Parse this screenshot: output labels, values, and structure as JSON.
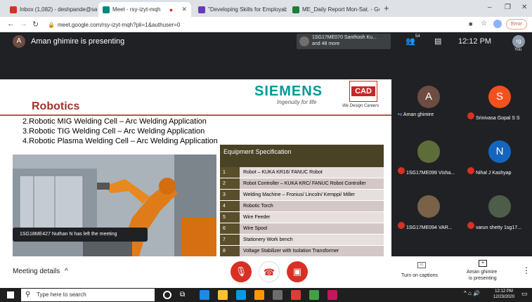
{
  "browser": {
    "tabs": [
      {
        "label": "Inbox (1,082) - deshpande@sapt",
        "icon": "gmail-icon",
        "color": "#d93025"
      },
      {
        "label": "Meet - rsy-izyt-mqh",
        "icon": "meet-icon",
        "color": "#00897b"
      },
      {
        "label": "\"Developing Skills for Employabi",
        "icon": "doc-icon",
        "color": "#673ab7"
      },
      {
        "label": "ME_Daily Report Mon-Sat. - Goo",
        "icon": "sheets-icon",
        "color": "#188038"
      }
    ],
    "url": "meet.google.com/rsy-izyt-mqh?pli=1&authuser=0",
    "error_label": "Error"
  },
  "meet": {
    "presenter_initial": "A",
    "presenting_text": "Aman ghimire is presenting",
    "pinned_name": "1SG17ME070 Santhosh Ku...",
    "pinned_more": "and 48 more",
    "participant_count": "54",
    "clock": "12:12 PM",
    "self_initials": "rg",
    "self_label": "You",
    "toast": "1SG18ME427 Nuthan N has left the meeting",
    "meeting_details": "Meeting details",
    "captions_label": "Turn on captions",
    "presenting_label_1": "Aman ghimire",
    "presenting_label_2": "is presenting"
  },
  "slide": {
    "brand": "SIEMENS",
    "tagline": "Ingenuity for life",
    "cad_logo": "CAD",
    "cad_tagline": "We Design Careers",
    "title": "Robotics",
    "bullets": [
      "2.Robotic MIG Welding Cell – Arc Welding Application",
      "3.Robotic TIG Welding Cell – Arc Welding Application",
      "4.Robotic Plasma Welding Cell – Arc Welding Application"
    ],
    "table_title": "Equipment Specification",
    "table_rows": [
      {
        "num": "1",
        "desc": "Robot – KUKA KR16/ FANUC Robot"
      },
      {
        "num": "2",
        "desc": "Robot Controller – KUKA KRC/ FANUC Robot Controller"
      },
      {
        "num": "3",
        "desc": "Welding Machine – Fronius/ Lincoln/ Kemppi/ Miller"
      },
      {
        "num": "4",
        "desc": "Robotic Torch"
      },
      {
        "num": "5",
        "desc": "Wire Feeder"
      },
      {
        "num": "6",
        "desc": "Wire Spool"
      },
      {
        "num": "7",
        "desc": "Stationery Work bench"
      },
      {
        "num": "8",
        "desc": "Voltage Stabilizer with Isolation Transformer"
      }
    ]
  },
  "participants": [
    {
      "name": "Aman ghimire",
      "initial": "A",
      "color": "#6d4c41",
      "muted": false
    },
    {
      "name": "Srinivasa Gopal S S",
      "initial": "S",
      "color": "#f4511e",
      "muted": true
    },
    {
      "name": "1SG17ME099 Visha...",
      "initial": "",
      "color": "#5d6d3a",
      "muted": true
    },
    {
      "name": "Nihal J Kashyap",
      "initial": "N",
      "color": "#1565c0",
      "muted": true
    },
    {
      "name": "1SG17ME094 VAR...",
      "initial": "",
      "color": "#7a6248",
      "muted": true
    },
    {
      "name": "varun shetty 1sg17...",
      "initial": "",
      "color": "#4e5d4a",
      "muted": true
    }
  ],
  "taskbar": {
    "search_placeholder": "Type here to search",
    "time": "12:12 PM",
    "date": "12/23/2020"
  }
}
